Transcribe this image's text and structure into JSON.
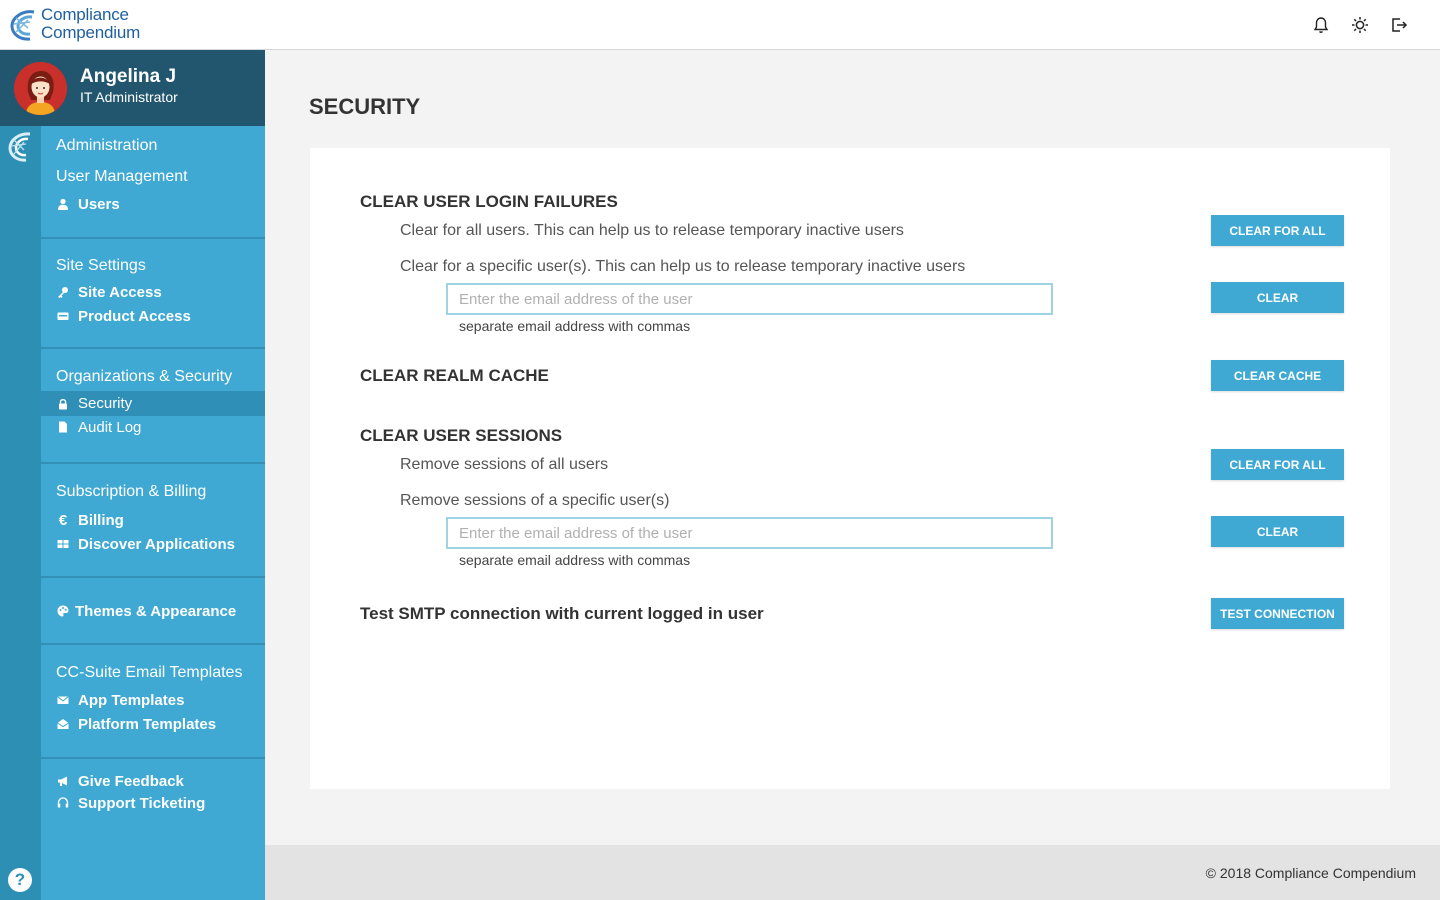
{
  "app": {
    "brand_line1": "Compliance",
    "brand_line2": "Compendium"
  },
  "header": {
    "icons": [
      "bell-icon",
      "theme-sun-icon",
      "logout-icon"
    ]
  },
  "profile": {
    "name": "Angelina J",
    "role": "IT Administrator"
  },
  "sidebar": {
    "section_admin": "Administration",
    "groups": [
      {
        "title": "User Management",
        "items": [
          {
            "label": "Users",
            "icon": "user-icon"
          }
        ]
      },
      {
        "title": "Site Settings",
        "items": [
          {
            "label": "Site Access",
            "icon": "key-icon"
          },
          {
            "label": "Product Access",
            "icon": "card-icon"
          }
        ]
      },
      {
        "title": "Organizations & Security",
        "items": [
          {
            "label": "Security",
            "icon": "lock-icon",
            "active": true
          },
          {
            "label": "Audit Log",
            "icon": "file-icon"
          }
        ]
      },
      {
        "title": "Subscription & Billing",
        "items": [
          {
            "label": "Billing",
            "icon": "euro-icon"
          },
          {
            "label": "Discover Applications",
            "icon": "grid-icon"
          }
        ]
      },
      {
        "title": "",
        "items": [
          {
            "label": "Themes & Appearance",
            "icon": "palette-icon"
          }
        ]
      },
      {
        "title": "CC-Suite Email Templates",
        "items": [
          {
            "label": "App Templates",
            "icon": "envelope-icon"
          },
          {
            "label": "Platform Templates",
            "icon": "envelope-open-icon"
          }
        ]
      },
      {
        "title": "",
        "items": [
          {
            "label": "Give Feedback",
            "icon": "megaphone-icon"
          },
          {
            "label": "Support Ticketing",
            "icon": "headset-icon"
          }
        ]
      }
    ],
    "help": "?"
  },
  "main": {
    "title": "SECURITY",
    "login_failures": {
      "title": "CLEAR USER LOGIN FAILURES",
      "all_desc": "Clear for all users. This can help us to release temporary inactive users",
      "all_button": "CLEAR FOR ALL",
      "specific_desc": "Clear for a specific user(s). This can help us to release temporary inactive users",
      "email_value": "",
      "email_placeholder": "Enter the email address of the user",
      "hint": "separate email address with commas",
      "specific_button": "CLEAR"
    },
    "realm_cache": {
      "title": "CLEAR REALM CACHE",
      "button": "CLEAR CACHE"
    },
    "sessions": {
      "title": "CLEAR USER SESSIONS",
      "all_desc": "Remove sessions of all users",
      "all_button": "CLEAR FOR ALL",
      "specific_desc": "Remove sessions of a specific user(s)",
      "email_value": "",
      "email_placeholder": "Enter the email address of the user",
      "hint": "separate email address with commas",
      "specific_button": "CLEAR"
    },
    "smtp": {
      "title": "Test SMTP connection with current logged in user",
      "button": "TEST CONNECTION"
    }
  },
  "footer": {
    "text": "© 2018 Compliance Compendium"
  },
  "colors": {
    "accent": "#3fa9d3",
    "rail": "#2e8fb4",
    "profile_bg": "#22566f",
    "brand": "#1f5f9e"
  }
}
